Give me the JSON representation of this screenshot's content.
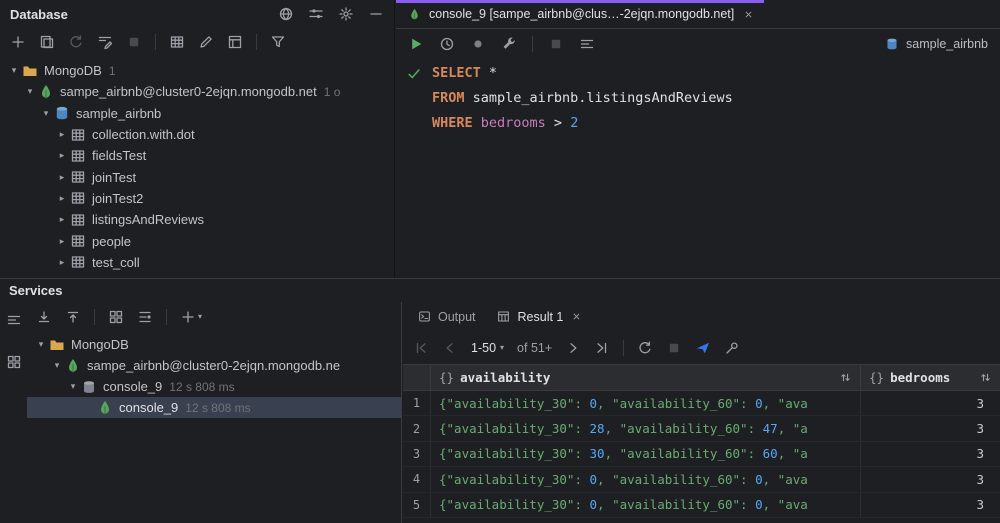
{
  "colors": {
    "accent_purple": "#8a5cf6",
    "mongo_green": "#57a65c",
    "keyword_orange": "#d7885a",
    "number_blue": "#56a8f5",
    "string_green": "#6aab73"
  },
  "database_panel": {
    "title": "Database",
    "tree": [
      {
        "depth": 0,
        "chevron": "open",
        "icon": "folder",
        "label": "MongoDB",
        "meta": "1"
      },
      {
        "depth": 1,
        "chevron": "open",
        "icon": "mongo",
        "label": "sampe_airbnb@cluster0-2ejqn.mongodb.net",
        "meta": "1 o"
      },
      {
        "depth": 2,
        "chevron": "open",
        "icon": "database",
        "label": "sample_airbnb",
        "meta": ""
      },
      {
        "depth": 3,
        "chevron": "closed",
        "icon": "collection",
        "label": "collection.with.dot",
        "meta": ""
      },
      {
        "depth": 3,
        "chevron": "closed",
        "icon": "collection",
        "label": "fieldsTest",
        "meta": ""
      },
      {
        "depth": 3,
        "chevron": "closed",
        "icon": "collection",
        "label": "joinTest",
        "meta": ""
      },
      {
        "depth": 3,
        "chevron": "closed",
        "icon": "collection",
        "label": "joinTest2",
        "meta": ""
      },
      {
        "depth": 3,
        "chevron": "closed",
        "icon": "collection",
        "label": "listingsAndReviews",
        "meta": ""
      },
      {
        "depth": 3,
        "chevron": "closed",
        "icon": "collection",
        "label": "people",
        "meta": ""
      },
      {
        "depth": 3,
        "chevron": "closed",
        "icon": "collection",
        "label": "test_coll",
        "meta": ""
      }
    ]
  },
  "editor": {
    "tab_label": "console_9 [sampe_airbnb@clus…-2ejqn.mongodb.net]",
    "datasource": "sample_airbnb",
    "lines": [
      {
        "gutter": "check",
        "segments": [
          {
            "text": "SELECT",
            "style": "keyword"
          },
          {
            "text": " *",
            "style": "plain"
          }
        ]
      },
      {
        "gutter": "",
        "segments": [
          {
            "text": "FROM",
            "style": "keyword"
          },
          {
            "text": " sample_airbnb.listingsAndReviews",
            "style": "plain"
          }
        ]
      },
      {
        "gutter": "",
        "segments": [
          {
            "text": "WHERE",
            "style": "keyword"
          },
          {
            "text": " bedrooms ",
            "style": "field"
          },
          {
            "text": "> ",
            "style": "plain"
          },
          {
            "text": "2",
            "style": "number"
          }
        ]
      }
    ]
  },
  "services_panel": {
    "title": "Services",
    "tree": [
      {
        "depth": 0,
        "chevron": "open",
        "icon": "folder",
        "label": "MongoDB",
        "time": "",
        "selected": false
      },
      {
        "depth": 1,
        "chevron": "open",
        "icon": "mongo",
        "label": "sampe_airbnb@cluster0-2ejqn.mongodb.ne",
        "time": "",
        "selected": false
      },
      {
        "depth": 2,
        "chevron": "open",
        "icon": "consoleDb",
        "label": "console_9",
        "time": "12 s 808 ms",
        "selected": false
      },
      {
        "depth": 3,
        "chevron": "none",
        "icon": "mongo",
        "label": "console_9",
        "time": "12 s 808 ms",
        "selected": true
      }
    ]
  },
  "result_panel": {
    "output_tab": "Output",
    "result_tab": "Result 1",
    "pager": {
      "range": "1-50",
      "total": "of 51+"
    },
    "grid": {
      "columns": [
        {
          "type": "{}",
          "name": "availability"
        },
        {
          "type": "{}",
          "name": "bedrooms"
        }
      ],
      "rows": [
        {
          "num": "1",
          "availability": "{\"availability_30\": 0, \"availability_60\": 0, \"ava",
          "bedrooms": "3"
        },
        {
          "num": "2",
          "availability": "{\"availability_30\": 28, \"availability_60\": 47, \"a",
          "bedrooms": "3"
        },
        {
          "num": "3",
          "availability": "{\"availability_30\": 30, \"availability_60\": 60, \"a",
          "bedrooms": "3"
        },
        {
          "num": "4",
          "availability": "{\"availability_30\": 0, \"availability_60\": 0, \"ava",
          "bedrooms": "3"
        },
        {
          "num": "5",
          "availability": "{\"availability_30\": 0, \"availability_60\": 0, \"ava",
          "bedrooms": "3"
        }
      ]
    }
  }
}
